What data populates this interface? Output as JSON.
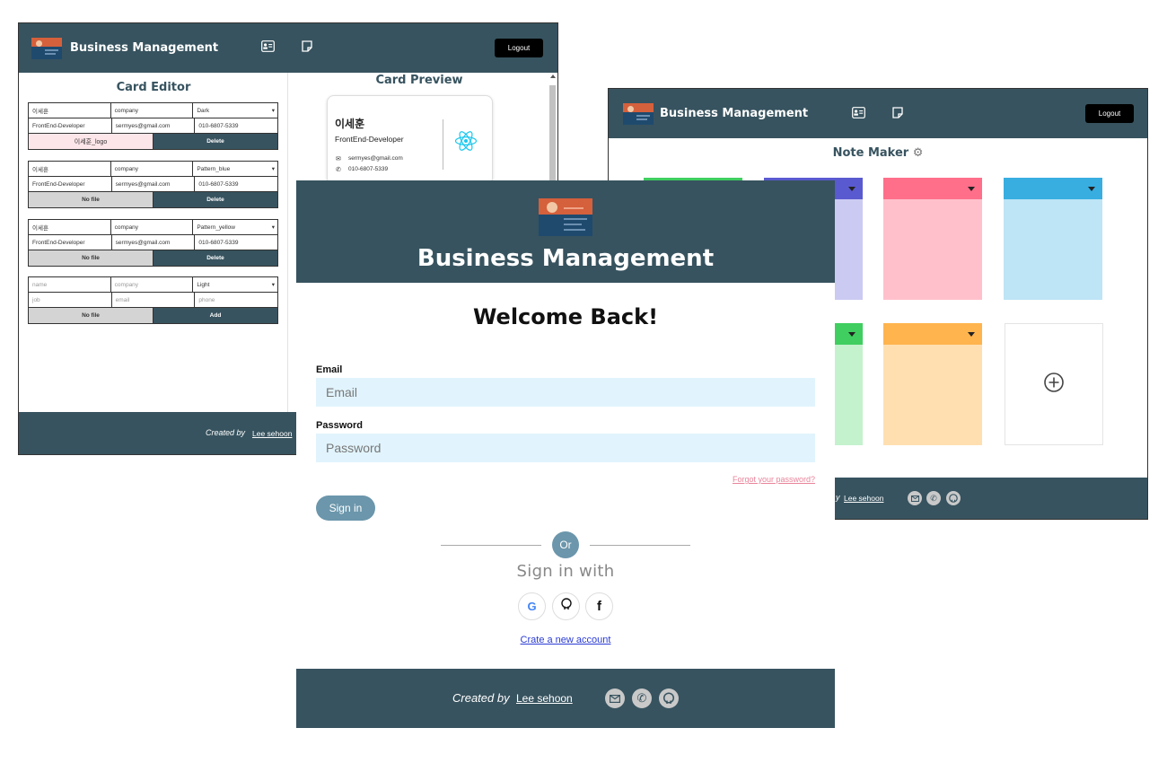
{
  "app": {
    "brand": "Business Management",
    "logout_label": "Logout"
  },
  "editor": {
    "title": "Card Editor",
    "preview_title": "Card Preview",
    "cards": [
      {
        "name": "이세훈",
        "company": "company",
        "theme": "Dark",
        "title": "FrontEnd-Developer",
        "email": "sermyes@gmail.com",
        "phone": "010-6807-5339",
        "file": "이세훈_logo",
        "action": "Delete"
      },
      {
        "name": "이세훈",
        "company": "company",
        "theme": "Pattern_blue",
        "title": "FrontEnd-Developer",
        "email": "sermyes@gmail.com",
        "phone": "010-6807-5339",
        "file": "No file",
        "action": "Delete"
      },
      {
        "name": "이세훈",
        "company": "company",
        "theme": "Pattern_yellow",
        "title": "FrontEnd-Developer",
        "email": "sermyes@gmail.com",
        "phone": "010-6807-5339",
        "file": "No file",
        "action": "Delete"
      }
    ],
    "new_card": {
      "name_ph": "name",
      "company_ph": "company",
      "theme": "Light",
      "job_ph": "job",
      "email_ph": "email",
      "phone_ph": "phone",
      "file": "No file",
      "action": "Add"
    },
    "preview": {
      "name": "이세훈",
      "title": "FrontEnd-Developer",
      "email": "sermyes@gmail.com",
      "phone": "010-6807-5339"
    },
    "footer_created": "Created by",
    "footer_author": "Lee sehoon"
  },
  "notes": {
    "title": "Note Maker",
    "footer_suffix": "y",
    "footer_author": "Lee sehoon",
    "colors": {
      "green": "#3fce5f",
      "purple": "#5a5ad0",
      "pink": "#ff6f8a",
      "blue": "#38aee0",
      "green_body": "#c4f2cd",
      "purple_body": "#cbcaf2",
      "pink_body": "#ffc0cc",
      "blue_body": "#bde5f6",
      "orange": "#ffb44e",
      "orange_body": "#ffdfb0"
    }
  },
  "login": {
    "welcome": "Welcome Back!",
    "email_label": "Email",
    "email_placeholder": "Email",
    "password_label": "Password",
    "password_placeholder": "Password",
    "forgot": "Forgot your password?",
    "signin": "Sign in",
    "or": "Or",
    "sign_in_with": "Sign in with",
    "create_account": "Crate a new account",
    "footer_created": "Created by",
    "footer_author": "Lee sehoon"
  }
}
